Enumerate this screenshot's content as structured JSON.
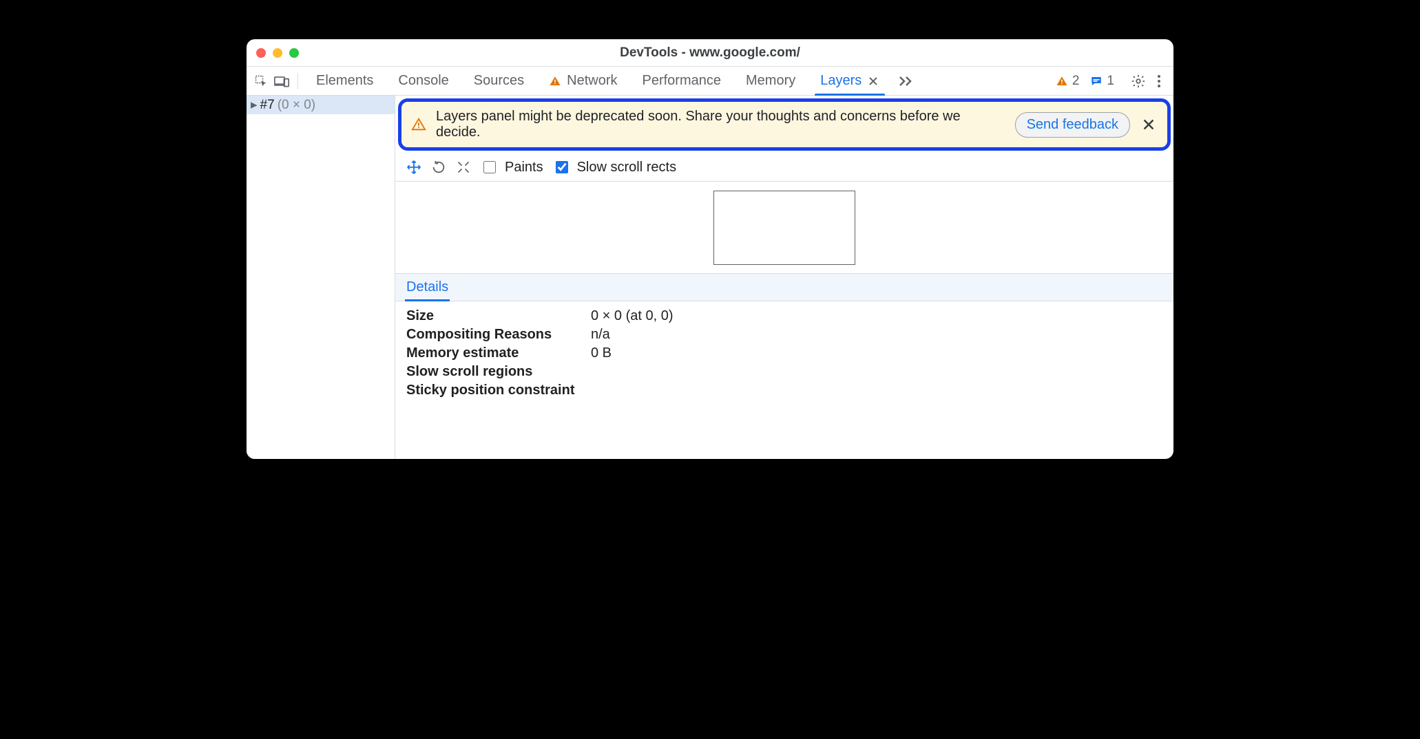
{
  "titlebar": {
    "title": "DevTools - www.google.com/"
  },
  "toolbar": {
    "tabs": [
      {
        "label": "Elements",
        "warn": false
      },
      {
        "label": "Console",
        "warn": false
      },
      {
        "label": "Sources",
        "warn": false
      },
      {
        "label": "Network",
        "warn": true
      },
      {
        "label": "Performance",
        "warn": false
      },
      {
        "label": "Memory",
        "warn": false
      }
    ],
    "active_tab": {
      "label": "Layers"
    },
    "warnings_count": "2",
    "messages_count": "1"
  },
  "sidebar": {
    "tree_item_id": "#7",
    "tree_item_dims": "(0 × 0)"
  },
  "banner": {
    "text": "Layers panel might be deprecated soon. Share your thoughts and concerns before we decide.",
    "button": "Send feedback"
  },
  "layer_toolbar": {
    "paints_label": "Paints",
    "paints_checked": false,
    "slow_label": "Slow scroll rects",
    "slow_checked": true
  },
  "details": {
    "tab_label": "Details",
    "rows": {
      "size_k": "Size",
      "size_v": "0 × 0 (at 0, 0)",
      "comp_k": "Compositing Reasons",
      "comp_v": "n/a",
      "mem_k": "Memory estimate",
      "mem_v": "0 B",
      "slow_k": "Slow scroll regions",
      "slow_v": "",
      "sticky_k": "Sticky position constraint",
      "sticky_v": ""
    }
  }
}
